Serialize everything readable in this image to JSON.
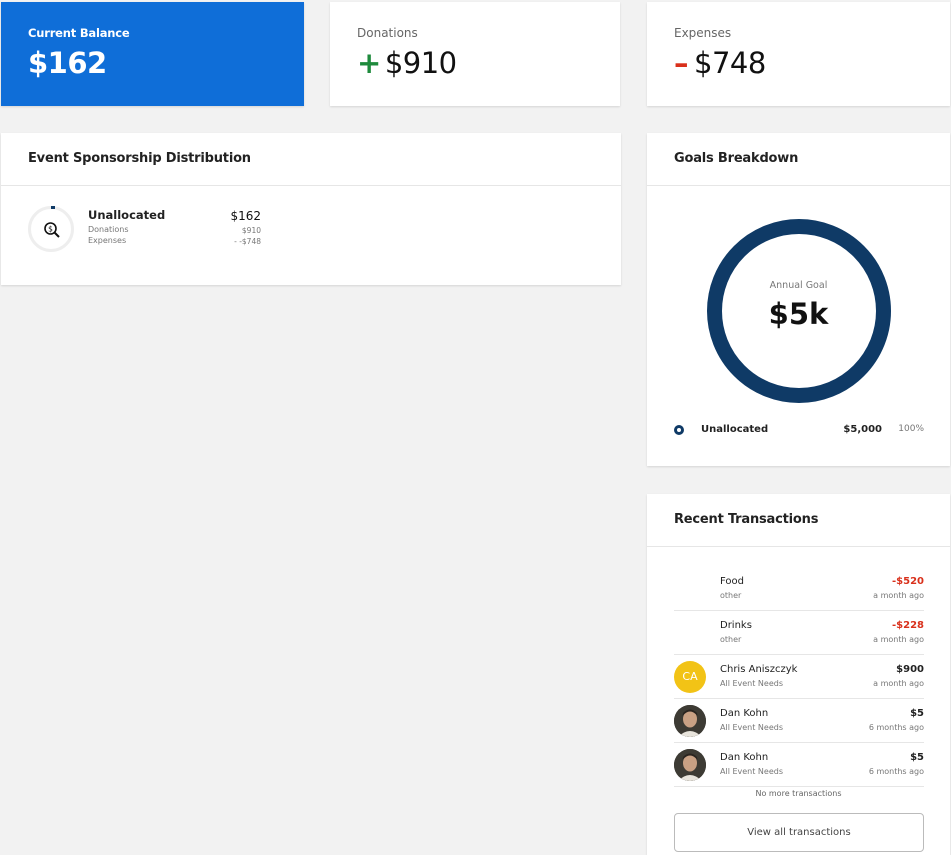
{
  "stats": {
    "balance": {
      "label": "Current Balance",
      "value": "$162"
    },
    "donations": {
      "label": "Donations",
      "sign": "+",
      "value": "$910"
    },
    "expenses": {
      "label": "Expenses",
      "sign": "–",
      "value": "$748"
    }
  },
  "sponsorship": {
    "title": "Event Sponsorship Distribution",
    "item": {
      "name": "Unallocated",
      "amount": "$162",
      "donations_label": "Donations",
      "donations_amount": "$910",
      "expenses_label": "Expenses",
      "expenses_amount": "- -$748",
      "icon": "search-dollar-icon"
    }
  },
  "goals": {
    "title": "Goals Breakdown",
    "caption": "Annual Goal",
    "value": "$5k",
    "legend": {
      "name": "Unallocated",
      "amount": "$5,000",
      "percent": "100%"
    },
    "ring_color": "#0f3a66"
  },
  "transactions": {
    "title": "Recent Transactions",
    "rows": [
      {
        "name": "Food",
        "category": "other",
        "amount": "-$520",
        "time": "a month ago",
        "negative": true,
        "avatar": ""
      },
      {
        "name": "Drinks",
        "category": "other",
        "amount": "-$228",
        "time": "a month ago",
        "negative": true,
        "avatar": ""
      },
      {
        "name": "Chris Aniszczyk",
        "category": "All Event Needs",
        "amount": "$900",
        "time": "a month ago",
        "negative": false,
        "avatar": "CA"
      },
      {
        "name": "Dan Kohn",
        "category": "All Event Needs",
        "amount": "$5",
        "time": "6 months ago",
        "negative": false,
        "avatar": "photo"
      },
      {
        "name": "Dan Kohn",
        "category": "All Event Needs",
        "amount": "$5",
        "time": "6 months ago",
        "negative": false,
        "avatar": "photo"
      }
    ],
    "no_more": "No more transactions",
    "view_all": "View all transactions"
  },
  "colors": {
    "primary": "#0f6ed8",
    "positive": "#1e8a3c",
    "negative": "#d9301b",
    "navy": "#0f3a66"
  }
}
